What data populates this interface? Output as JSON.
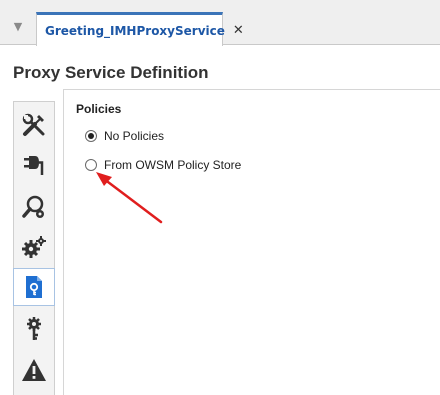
{
  "editor_tabs": {
    "menu_icon": "triangle-down-icon",
    "active_tab": {
      "title": "Greeting_IMHProxyService",
      "close_glyph": "✕"
    }
  },
  "page": {
    "title": "Proxy Service Definition"
  },
  "side_nav": {
    "items": [
      {
        "id": "general",
        "icon": "tools-icon",
        "active": false
      },
      {
        "id": "transport",
        "icon": "plug-icon",
        "active": false
      },
      {
        "id": "transport-details",
        "icon": "search-gear-icon",
        "active": false
      },
      {
        "id": "configuration",
        "icon": "gears-icon",
        "active": false
      },
      {
        "id": "policies",
        "icon": "document-key-icon",
        "active": true
      },
      {
        "id": "security",
        "icon": "key-gear-icon",
        "active": false
      },
      {
        "id": "warnings",
        "icon": "warning-icon",
        "active": false
      }
    ]
  },
  "policies": {
    "heading": "Policies",
    "options": [
      {
        "label": "No Policies",
        "selected": true
      },
      {
        "label": "From OWSM Policy Store",
        "selected": false
      }
    ]
  },
  "annotation": {
    "color": "#e01e1e"
  }
}
